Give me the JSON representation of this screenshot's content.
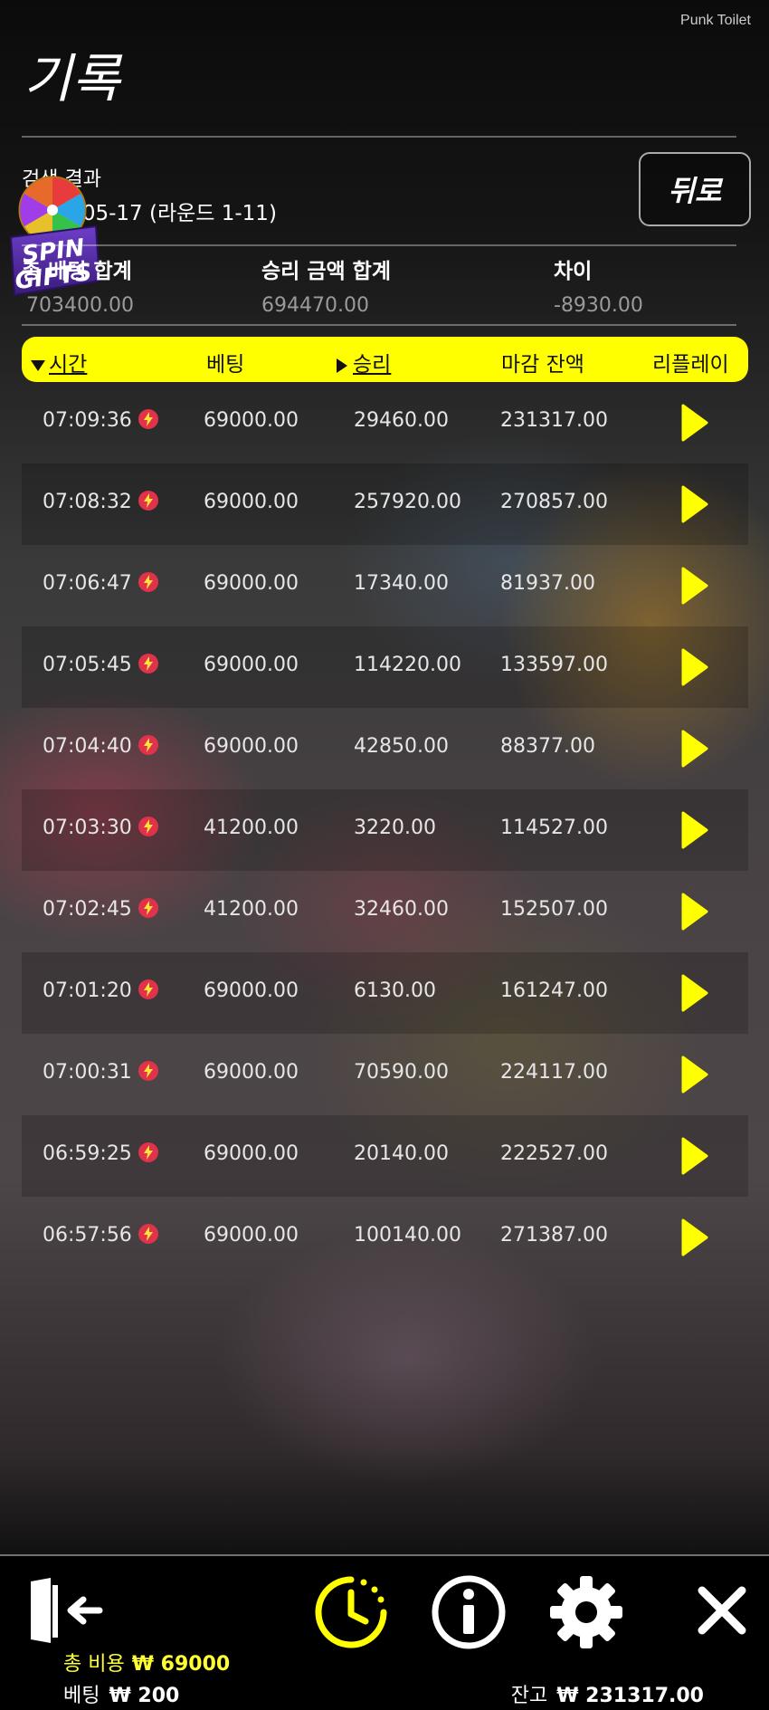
{
  "brand": "Punk Toilet",
  "title": "기록",
  "search": {
    "label": "검색 결과",
    "date": "2025-05-17 (라운드 1-11)"
  },
  "back_label": "뒤로",
  "promo": {
    "line1": "SPIN",
    "line2": "GIFTS"
  },
  "summary": [
    {
      "label": "총 베팅 합계",
      "value": "703400.00"
    },
    {
      "label": "승리 금액 합계",
      "value": "694470.00"
    },
    {
      "label": "차이",
      "value": "-8930.00"
    }
  ],
  "columns": {
    "time": "시간",
    "bet": "베팅",
    "win": "승리",
    "balance": "마감 잔액",
    "replay": "리플레이"
  },
  "rows": [
    {
      "time": "07:09:36",
      "bet": "69000.00",
      "win": "29460.00",
      "balance": "231317.00"
    },
    {
      "time": "07:08:32",
      "bet": "69000.00",
      "win": "257920.00",
      "balance": "270857.00"
    },
    {
      "time": "07:06:47",
      "bet": "69000.00",
      "win": "17340.00",
      "balance": "81937.00"
    },
    {
      "time": "07:05:45",
      "bet": "69000.00",
      "win": "114220.00",
      "balance": "133597.00"
    },
    {
      "time": "07:04:40",
      "bet": "69000.00",
      "win": "42850.00",
      "balance": "88377.00"
    },
    {
      "time": "07:03:30",
      "bet": "41200.00",
      "win": "3220.00",
      "balance": "114527.00"
    },
    {
      "time": "07:02:45",
      "bet": "41200.00",
      "win": "32460.00",
      "balance": "152507.00"
    },
    {
      "time": "07:01:20",
      "bet": "69000.00",
      "win": "6130.00",
      "balance": "161247.00"
    },
    {
      "time": "07:00:31",
      "bet": "69000.00",
      "win": "70590.00",
      "balance": "224117.00"
    },
    {
      "time": "06:59:25",
      "bet": "69000.00",
      "win": "20140.00",
      "balance": "222527.00"
    },
    {
      "time": "06:57:56",
      "bet": "69000.00",
      "win": "100140.00",
      "balance": "271387.00"
    }
  ],
  "footer": {
    "total_cost_label": "총 비용",
    "total_cost_value": "₩ 69000",
    "bet_label": "베팅",
    "bet_value": "₩ 200",
    "balance_label": "잔고",
    "balance_value": "₩ 231317.00"
  },
  "colors": {
    "accent": "#ffff00",
    "bolt": "#e0324a"
  },
  "icons": [
    "exit-icon",
    "history-icon",
    "info-icon",
    "settings-icon",
    "close-icon",
    "replay-play-icon",
    "bolt-icon"
  ]
}
